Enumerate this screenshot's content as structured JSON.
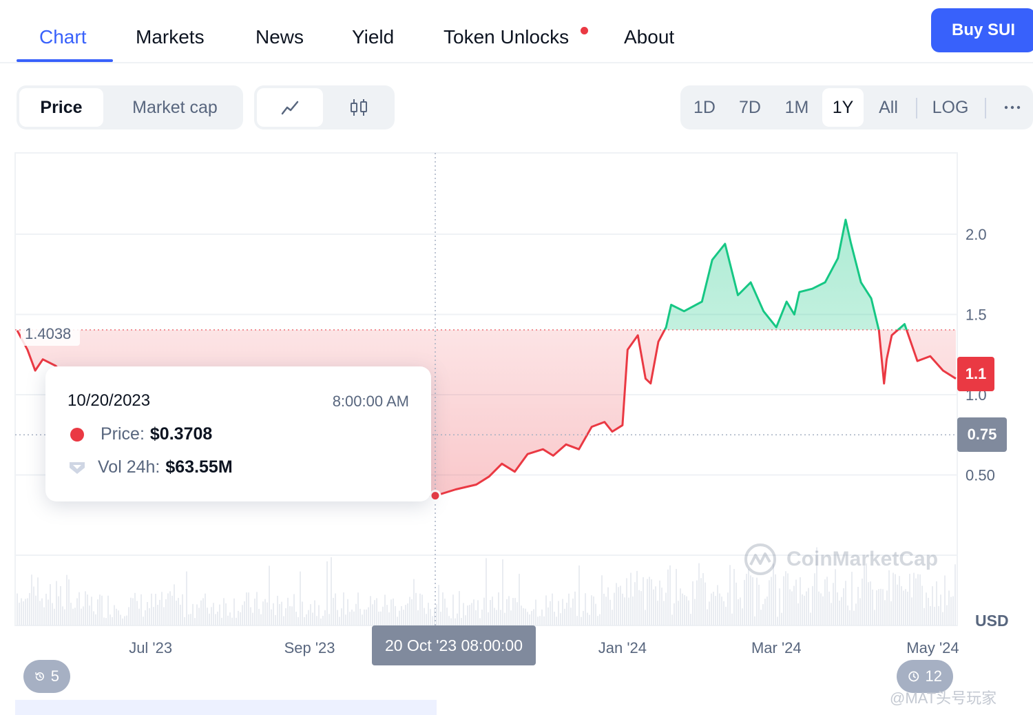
{
  "nav": {
    "tabs": [
      {
        "label": "Chart",
        "active": true
      },
      {
        "label": "Markets"
      },
      {
        "label": "News"
      },
      {
        "label": "Yield"
      },
      {
        "label": "Token Unlocks",
        "badge": true
      },
      {
        "label": "About"
      }
    ],
    "buy_label": "Buy SUI"
  },
  "controls": {
    "metric_tabs": [
      {
        "label": "Price",
        "selected": true
      },
      {
        "label": "Market cap"
      }
    ],
    "chart_types": [
      {
        "icon": "line-chart-icon",
        "selected": true
      },
      {
        "icon": "candlestick-icon"
      }
    ],
    "ranges": [
      {
        "label": "1D"
      },
      {
        "label": "7D"
      },
      {
        "label": "1M"
      },
      {
        "label": "1Y",
        "selected": true
      },
      {
        "label": "All"
      }
    ],
    "log_label": "LOG",
    "more_icon": "more-icon"
  },
  "tooltip": {
    "date": "10/20/2023",
    "time": "8:00:00 AM",
    "price_label": "Price:",
    "price_value": "$0.3708",
    "vol_label": "Vol 24h:",
    "vol_value": "$63.55M"
  },
  "labels": {
    "crosshair_date": "20 Oct '23 08:00:00",
    "current_price": "1.1",
    "crosshair_price": "0.75",
    "start_price": "1.4038",
    "currency": "USD",
    "watermark": "CoinMarketCap",
    "events_left": "5",
    "events_right": "12",
    "credit": "@MAT头号玩家"
  },
  "colors": {
    "accent": "#3861fb",
    "up": "#16c784",
    "down": "#ea3943",
    "muted": "#58667e"
  },
  "chart_data": {
    "type": "line",
    "title": "",
    "xlabel": "",
    "ylabel": "USD",
    "y_ticks": [
      "2.0",
      "1.5",
      "1.0",
      "0.50"
    ],
    "x_ticks": [
      "Jul '23",
      "Sep '23",
      "Jan '24",
      "Mar '24",
      "May '24"
    ],
    "baseline": 1.4038,
    "ylim": [
      0,
      2.5
    ],
    "x": [
      "2023-05-10",
      "2023-05-14",
      "2023-05-17",
      "2023-05-20",
      "2023-05-25",
      "2023-06-01",
      "2023-06-10",
      "2023-06-20",
      "2023-07-01",
      "2023-07-15",
      "2023-08-01",
      "2023-08-15",
      "2023-09-01",
      "2023-09-15",
      "2023-10-01",
      "2023-10-10",
      "2023-10-20",
      "2023-10-28",
      "2023-11-05",
      "2023-11-10",
      "2023-11-15",
      "2023-11-20",
      "2023-11-25",
      "2023-12-01",
      "2023-12-05",
      "2023-12-10",
      "2023-12-15",
      "2023-12-20",
      "2023-12-25",
      "2023-12-28",
      "2024-01-01",
      "2024-01-03",
      "2024-01-07",
      "2024-01-10",
      "2024-01-12",
      "2024-01-15",
      "2024-01-18",
      "2024-01-20",
      "2024-01-25",
      "2024-02-01",
      "2024-02-05",
      "2024-02-10",
      "2024-02-15",
      "2024-02-20",
      "2024-02-25",
      "2024-03-01",
      "2024-03-05",
      "2024-03-08",
      "2024-03-10",
      "2024-03-15",
      "2024-03-20",
      "2024-03-25",
      "2024-03-28",
      "2024-03-30",
      "2024-04-03",
      "2024-04-07",
      "2024-04-10",
      "2024-04-12",
      "2024-04-13",
      "2024-04-15",
      "2024-04-20",
      "2024-04-25",
      "2024-04-30",
      "2024-05-05",
      "2024-05-10"
    ],
    "values": [
      1.4,
      1.28,
      1.15,
      1.22,
      1.18,
      1.05,
      0.88,
      0.78,
      0.68,
      0.58,
      0.5,
      0.46,
      0.43,
      0.4,
      0.39,
      0.38,
      0.37,
      0.41,
      0.44,
      0.49,
      0.57,
      0.52,
      0.63,
      0.66,
      0.62,
      0.69,
      0.66,
      0.8,
      0.83,
      0.77,
      0.81,
      1.28,
      1.37,
      1.1,
      1.07,
      1.33,
      1.42,
      1.56,
      1.52,
      1.58,
      1.84,
      1.94,
      1.62,
      1.7,
      1.52,
      1.42,
      1.58,
      1.5,
      1.64,
      1.66,
      1.7,
      1.85,
      2.09,
      1.95,
      1.7,
      1.6,
      1.4,
      1.07,
      1.22,
      1.37,
      1.44,
      1.21,
      1.24,
      1.15,
      1.1
    ],
    "crosshair": {
      "date": "2023-10-20",
      "price": 0.3708
    }
  }
}
